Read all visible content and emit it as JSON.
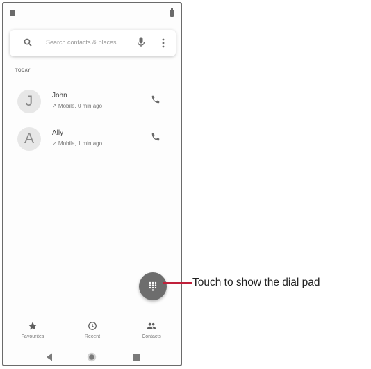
{
  "search": {
    "placeholder": "Search contacts & places"
  },
  "section": {
    "label": "TODAY"
  },
  "contacts": [
    {
      "initial": "J",
      "name": "John",
      "detail": "↗ Mobile, 0 min ago"
    },
    {
      "initial": "A",
      "name": "Ally",
      "detail": "↗ Mobile, 1 min ago"
    }
  ],
  "fab": {
    "icon": "dialpad-icon"
  },
  "bottom_nav": [
    {
      "label": "Favourites",
      "icon": "star-icon"
    },
    {
      "label": "Recent",
      "icon": "clock-icon"
    },
    {
      "label": "Contacts",
      "icon": "people-icon"
    }
  ],
  "system_nav": {
    "icons": [
      "back-icon",
      "home-icon",
      "recents-icon"
    ]
  },
  "annotation": {
    "text": "Touch to show the dial pad",
    "line_color": "#c0203a"
  },
  "colors": {
    "icon_gray": "#6d6d6d",
    "avatar_bg": "#e7e7e7",
    "frame": "#6b6b6b"
  }
}
